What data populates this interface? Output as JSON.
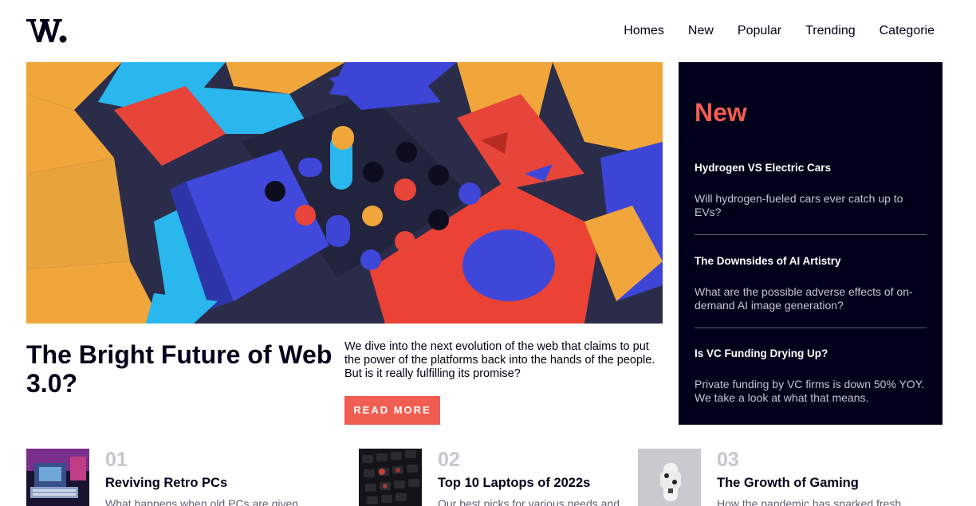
{
  "logo": {
    "text": "W."
  },
  "nav": {
    "items": [
      "Homes",
      "New",
      "Popular",
      "Trending",
      "Categorie"
    ]
  },
  "hero": {
    "title": "The Bright Future of Web 3.0?",
    "description": "We dive into the next evolution of the web that claims to put the power of the platforms back into the hands of the people. But is it really fulfilling its promise?",
    "button_label": "READ MORE"
  },
  "new_panel": {
    "heading": "New",
    "items": [
      {
        "title": "Hydrogen VS Electric Cars",
        "text": "Will hydrogen-fueled cars ever catch up to EVs?"
      },
      {
        "title": "The Downsides of AI Artistry",
        "text": "What are the possible adverse effects of on-demand AI image generation?"
      },
      {
        "title": "Is VC Funding Drying Up?",
        "text": "Private funding by VC firms is down 50% YOY. We take a look at what that means."
      }
    ]
  },
  "articles": [
    {
      "number": "01",
      "title": "Reviving Retro PCs",
      "text": "What happens when old PCs are given"
    },
    {
      "number": "02",
      "title": "Top 10 Laptops of 2022",
      "title_suffix": "s",
      "text": "Our best picks for various needs and"
    },
    {
      "number": "03",
      "title": "The Growth of Gaming",
      "text": "How the pandemic has sparked fresh"
    }
  ],
  "colors": {
    "accent": "#f15d51",
    "dark": "#00001a",
    "highlight": "#e9ab53"
  }
}
